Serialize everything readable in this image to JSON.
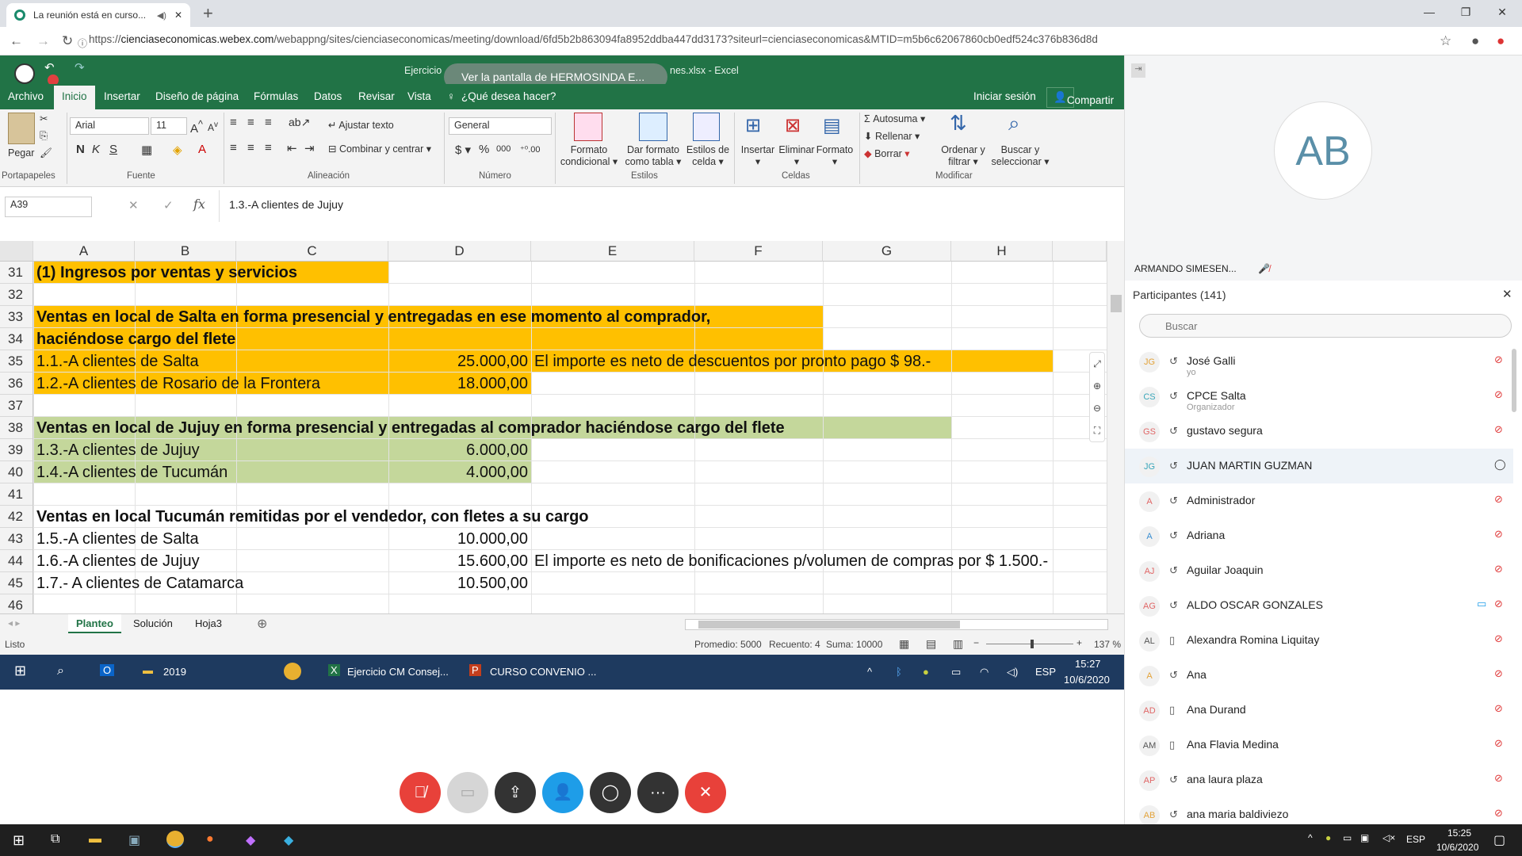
{
  "chrome": {
    "tab_title": "La reunión está en curso...",
    "url_prefix": "https://",
    "url_host": "cienciaseconomicas.webex.com",
    "url_path": "/webappng/sites/cienciaseconomicas/meeting/download/6fd5b2b863094fa8952ddba447dd3173?siteurl=cienciaseconomicas&MTID=m5b6c62067860cb0edf524c376b836d8d"
  },
  "share_banner": "Ver la pantalla de  HERMOSINDA E...",
  "excel": {
    "title_left": "Ejercicio",
    "title_right": "nes.xlsx - Excel",
    "menu": [
      "Archivo",
      "Inicio",
      "Insertar",
      "Diseño de página",
      "Fórmulas",
      "Datos",
      "Revisar",
      "Vista"
    ],
    "tell_me": "¿Qué desea hacer?",
    "sign_in": "Iniciar sesión",
    "share": "Compartir",
    "font_name": "Arial",
    "font_size": "11",
    "number_format": "General",
    "ribbon": {
      "pegar": "Pegar",
      "ajustar": "Ajustar texto",
      "combinar": "Combinar y centrar",
      "formato_cond_1": "Formato",
      "formato_cond_2": "condicional",
      "dar_formato_1": "Dar formato",
      "dar_formato_2": "como tabla",
      "estilos_1": "Estilos de",
      "estilos_2": "celda",
      "insertar": "Insertar",
      "eliminar": "Eliminar",
      "formato": "Formato",
      "autosuma": "Autosuma",
      "rellenar": "Rellenar",
      "borrar": "Borrar",
      "ordenar_1": "Ordenar y",
      "ordenar_2": "filtrar",
      "buscar_1": "Buscar y",
      "buscar_2": "seleccionar"
    },
    "groups": [
      "Portapapeles",
      "Fuente",
      "Alineación",
      "Número",
      "Estilos",
      "Celdas",
      "Modificar"
    ],
    "name_box": "A39",
    "formula": "1.3.-A clientes de Jujuy",
    "columns": [
      "A",
      "B",
      "C",
      "D",
      "E",
      "F",
      "G",
      "H"
    ],
    "rows": [
      {
        "n": "31",
        "a": "(1) Ingresos por ventas y servicios",
        "d": "",
        "e": ""
      },
      {
        "n": "32",
        "a": "",
        "d": "",
        "e": ""
      },
      {
        "n": "33",
        "a": "Ventas en local de Salta en forma presencial y entregadas en ese momento al comprador,",
        "d": "",
        "e": ""
      },
      {
        "n": "34",
        "a": "haciéndose cargo del flete",
        "d": "",
        "e": ""
      },
      {
        "n": "35",
        "a": "1.1.-A clientes de Salta",
        "d": "25.000,00",
        "e": "El importe es neto de descuentos por pronto pago $ 98.-"
      },
      {
        "n": "36",
        "a": "1.2.-A clientes de Rosario de la Frontera",
        "d": "18.000,00",
        "e": ""
      },
      {
        "n": "37",
        "a": "",
        "d": "",
        "e": ""
      },
      {
        "n": "38",
        "a": "Ventas en local de Jujuy en forma presencial y entregadas al comprador haciéndose cargo del flete",
        "d": "",
        "e": ""
      },
      {
        "n": "39",
        "a": "1.3.-A clientes de Jujuy",
        "d": "6.000,00",
        "e": ""
      },
      {
        "n": "40",
        "a": "1.4.-A clientes de Tucumán",
        "d": "4.000,00",
        "e": ""
      },
      {
        "n": "41",
        "a": "",
        "d": "",
        "e": ""
      },
      {
        "n": "42",
        "a": "Ventas en local Tucumán remitidas por el vendedor, con fletes a su cargo",
        "d": "",
        "e": ""
      },
      {
        "n": "43",
        "a": "1.5.-A clientes de Salta",
        "d": "10.000,00",
        "e": ""
      },
      {
        "n": "44",
        "a": "1.6.-A clientes de Jujuy",
        "d": "15.600,00",
        "e": "El importe es neto de bonificaciones p/volumen de compras por $ 1.500.-"
      },
      {
        "n": "45",
        "a": "1.7.- A clientes de Catamarca",
        "d": "10.500,00",
        "e": ""
      },
      {
        "n": "46",
        "a": "",
        "d": "",
        "e": ""
      }
    ],
    "sheets": [
      "Planteo",
      "Solución",
      "Hoja3"
    ],
    "status_left": "Listo",
    "status_avg": "Promedio: 5000",
    "status_count": "Recuento: 4",
    "status_sum": "Suma: 10000",
    "zoom": "137 %"
  },
  "inner_taskbar": {
    "folder": "2019",
    "excel_item": "Ejercicio CM Consej...",
    "ppt_item": "CURSO CONVENIO ...",
    "lang": "ESP",
    "time": "15:27",
    "date": "10/6/2020"
  },
  "panel": {
    "avatar": "AB",
    "video_label": "ARMANDO SIMESEN...",
    "participants_title": "Participantes (141)",
    "search_placeholder": "Buscar",
    "participants": [
      {
        "ini": "JG",
        "name": "José Galli",
        "sub": "yo",
        "color": "#e3a33a"
      },
      {
        "ini": "CS",
        "name": "CPCE Salta",
        "sub": "Organizador",
        "color": "#3aa6b9"
      },
      {
        "ini": "GS",
        "name": "gustavo segura",
        "sub": "",
        "color": "#e06666"
      },
      {
        "ini": "JG",
        "name": "JUAN MARTIN GUZMAN",
        "sub": "",
        "color": "#3aa6b9"
      },
      {
        "ini": "A",
        "name": "Administrador",
        "sub": "",
        "color": "#e06666"
      },
      {
        "ini": "A",
        "name": "Adriana",
        "sub": "",
        "color": "#3a8ed1"
      },
      {
        "ini": "AJ",
        "name": "Aguilar Joaquin",
        "sub": "",
        "color": "#e06666"
      },
      {
        "ini": "AG",
        "name": "ALDO OSCAR GONZALES",
        "sub": "",
        "color": "#e06666"
      },
      {
        "ini": "AL",
        "name": "Alexandra Romina Liquitay",
        "sub": "",
        "color": "#555"
      },
      {
        "ini": "A",
        "name": "Ana",
        "sub": "",
        "color": "#e3a33a"
      },
      {
        "ini": "AD",
        "name": "Ana Durand",
        "sub": "",
        "color": "#e06666"
      },
      {
        "ini": "AM",
        "name": "Ana Flavia Medina",
        "sub": "",
        "color": "#555"
      },
      {
        "ini": "AP",
        "name": "ana laura plaza",
        "sub": "",
        "color": "#e06666"
      },
      {
        "ini": "AB",
        "name": "ana maria baldiviezo",
        "sub": "",
        "color": "#e3a33a"
      }
    ]
  },
  "os_taskbar": {
    "lang": "ESP",
    "time": "15:25",
    "date": "10/6/2020"
  },
  "colors": {
    "excel_green": "#217346",
    "orange_fill": "#ffc000",
    "green_fill": "#c4d79b",
    "end_call": "#e8413a"
  }
}
